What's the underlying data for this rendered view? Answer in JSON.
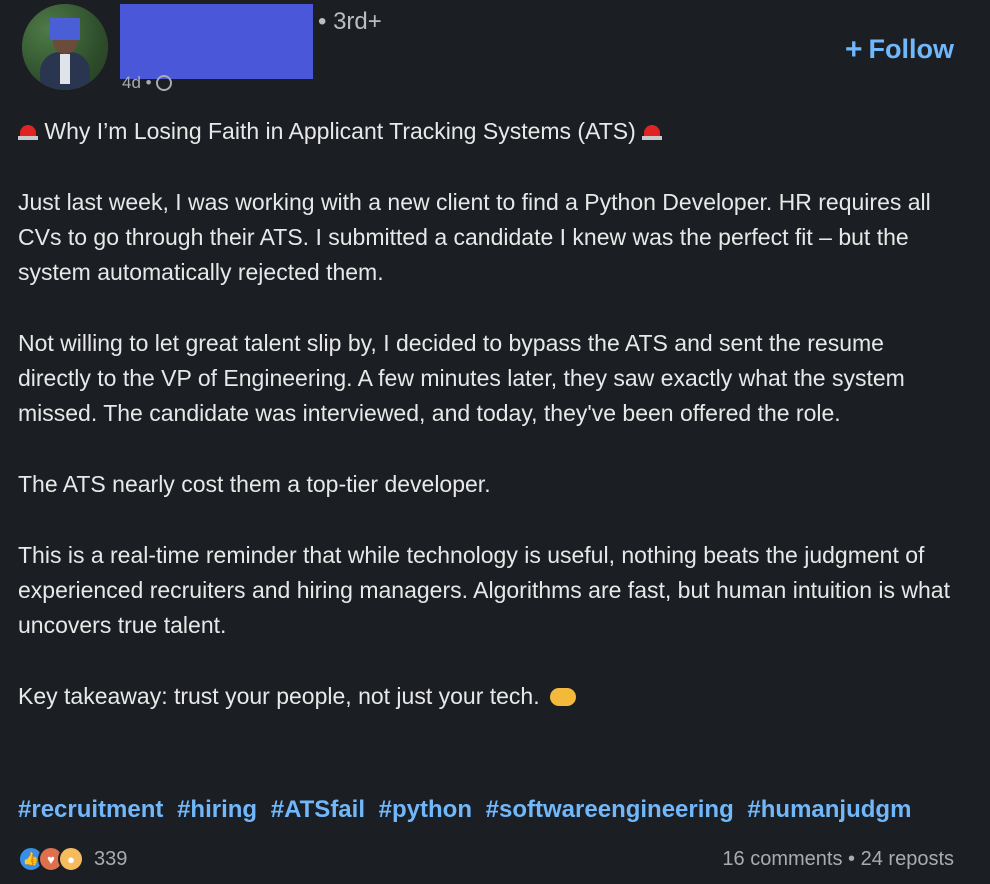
{
  "author": {
    "degree": "• 3rd+",
    "time": "4d •"
  },
  "follow_label": "Follow",
  "post": {
    "title": "Why I’m Losing Faith in Applicant Tracking Systems (ATS)",
    "paragraphs": [
      "Just last week, I was working with a new client to find a Python Developer. HR requires all CVs to go through their ATS. I submitted a candidate I knew was the perfect fit – but the system automatically rejected them.",
      "Not willing to let great talent slip by, I decided to bypass the ATS and sent the resume directly to the VP of Engineering. A few minutes later, they saw exactly what the system missed. The candidate was interviewed, and today, they've been offered the role.",
      "The ATS nearly cost them a top-tier developer.",
      "This is a real-time reminder that while technology is useful, nothing beats the judgment of experienced recruiters and hiring managers. Algorithms are fast, but human intuition is what uncovers true talent.",
      "Key takeaway: trust your people, not just your tech."
    ],
    "hashtags": [
      "#recruitment",
      "#hiring",
      "#ATSfail",
      "#python",
      "#softwareengineering",
      "#humanjudgm"
    ]
  },
  "footer": {
    "reaction_count": "339",
    "comments": "16 comments",
    "separator": "•",
    "reposts": "24 reposts"
  },
  "icons": {
    "title_emoji": "police-siren-icon",
    "takeaway_emoji": "handshake-icon",
    "visibility": "globe-icon"
  },
  "colors": {
    "background": "#1b1f23",
    "link": "#71b7fb",
    "redaction": "#4b57d9"
  }
}
